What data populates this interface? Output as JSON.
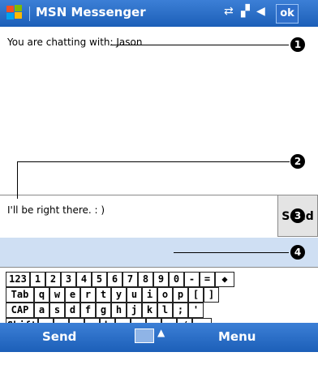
{
  "window": {
    "title": "MSN Messenger",
    "ok_label": "ok",
    "icons": [
      "windows-flag-icon",
      "connectivity-icon",
      "signal-icon",
      "volume-icon",
      "battery-icon"
    ]
  },
  "chat": {
    "header": "You are chatting with: Jason"
  },
  "compose": {
    "text": "I'll be right there. : )",
    "send_label": "Send"
  },
  "keyboard": {
    "rows": [
      [
        "123",
        "1",
        "2",
        "3",
        "4",
        "5",
        "6",
        "7",
        "8",
        "9",
        "0",
        "-",
        "=",
        "◆"
      ],
      [
        "Tab",
        "q",
        "w",
        "e",
        "r",
        "t",
        "y",
        "u",
        "i",
        "o",
        "p",
        "[",
        "]"
      ],
      [
        "CAP",
        "a",
        "s",
        "d",
        "f",
        "g",
        "h",
        "j",
        "k",
        "l",
        ";",
        "'"
      ],
      [
        "Shift",
        "z",
        "x",
        "c",
        "v",
        "b",
        "n",
        "m",
        ",",
        ".",
        "/",
        "↵"
      ],
      [
        "Ctl",
        "áü",
        "`",
        "\\",
        "↓",
        "↑",
        "←",
        "→"
      ]
    ]
  },
  "bottom_bar": {
    "left_label": "Send",
    "right_label": "Menu"
  },
  "callouts": [
    "1",
    "2",
    "3",
    "4"
  ]
}
